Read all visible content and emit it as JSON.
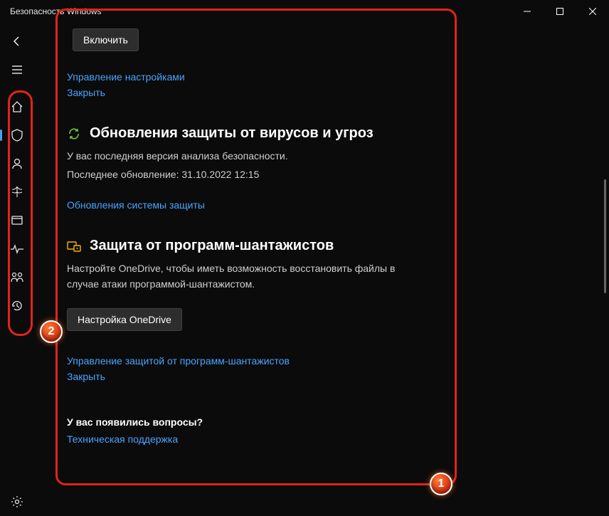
{
  "window": {
    "title": "Безопасность Windows"
  },
  "sidebar": {
    "items": [
      {
        "name": "back"
      },
      {
        "name": "menu"
      },
      {
        "name": "home"
      },
      {
        "name": "virus-protection"
      },
      {
        "name": "account-protection"
      },
      {
        "name": "firewall"
      },
      {
        "name": "app-browser"
      },
      {
        "name": "device-security"
      },
      {
        "name": "family-options"
      },
      {
        "name": "protection-history"
      }
    ]
  },
  "top": {
    "enable_button": "Включить",
    "manage_link": "Управление настройками",
    "close_link": "Закрыть"
  },
  "updates": {
    "title": "Обновления защиты от вирусов и угроз",
    "status": "У вас последняя версия анализа безопасности.",
    "last": "Последнее обновление: 31.10.2022 12:15",
    "link": "Обновления системы защиты"
  },
  "ransomware": {
    "title": "Защита от программ-шантажистов",
    "desc": "Настройте OneDrive, чтобы иметь возможность восстановить файлы в случае атаки программой-шантажистом.",
    "button": "Настройка OneDrive",
    "manage_link": "Управление защитой от программ-шантажистов",
    "close_link": "Закрыть"
  },
  "help": {
    "title": "У вас появились вопросы?",
    "link": "Техническая поддержка"
  },
  "callouts": {
    "one": "1",
    "two": "2"
  }
}
